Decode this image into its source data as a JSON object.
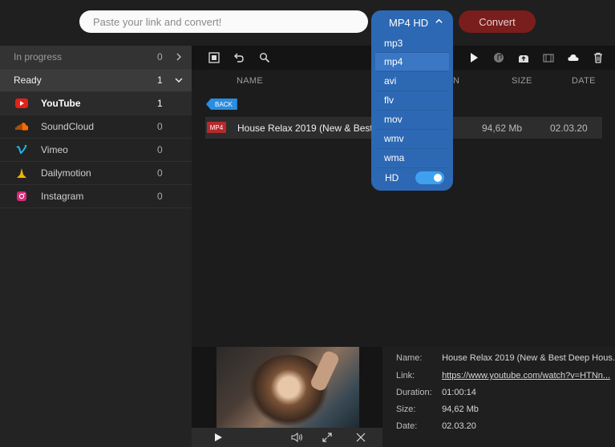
{
  "top": {
    "url_placeholder": "Paste your link and convert!",
    "format_label": "MP4 HD",
    "convert_label": "Convert"
  },
  "dropdown": {
    "options": [
      "mp3",
      "mp4",
      "avi",
      "flv",
      "mov",
      "wmv",
      "wma"
    ],
    "selected": "mp4",
    "hd_label": "HD",
    "hd_enabled": true
  },
  "sidebar": {
    "in_progress": {
      "label": "In progress",
      "count": "0"
    },
    "ready": {
      "label": "Ready",
      "count": "1"
    },
    "sources": [
      {
        "label": "YouTube",
        "count": "1",
        "icon": "youtube-icon",
        "color": "#e62117"
      },
      {
        "label": "SoundCloud",
        "count": "0",
        "icon": "soundcloud-icon",
        "color": "#ff6a00"
      },
      {
        "label": "Vimeo",
        "count": "0",
        "icon": "vimeo-icon",
        "color": "#1ab7ea"
      },
      {
        "label": "Dailymotion",
        "count": "0",
        "icon": "dailymotion-icon",
        "color": "#f2b400"
      },
      {
        "label": "Instagram",
        "count": "0",
        "icon": "instagram-icon",
        "color": "#d62976"
      }
    ]
  },
  "list": {
    "columns": {
      "name": "NAME",
      "duration_partial": "N",
      "size": "SIZE",
      "date": "DATE"
    },
    "back_label": "BACK",
    "files": [
      {
        "format": "MP4",
        "name": "House Relax 2019 (New & Best D...",
        "size": "94,62 Mb",
        "date": "02.03.20"
      }
    ]
  },
  "details": {
    "name_key": "Name:",
    "name": "House Relax 2019 (New & Best Deep Hous...",
    "link_key": "Link:",
    "link": "https://www.youtube.com/watch?v=HTNn...",
    "duration_key": "Duration:",
    "duration": "01:00:14",
    "size_key": "Size:",
    "size": "94,62 Mb",
    "date_key": "Date:",
    "date": "02.03.20"
  },
  "colors": {
    "accent_blue": "#2d68b4",
    "convert_red": "#7a1d1d",
    "badge_red": "#b8282c",
    "back_blue": "#2a8ee0"
  }
}
